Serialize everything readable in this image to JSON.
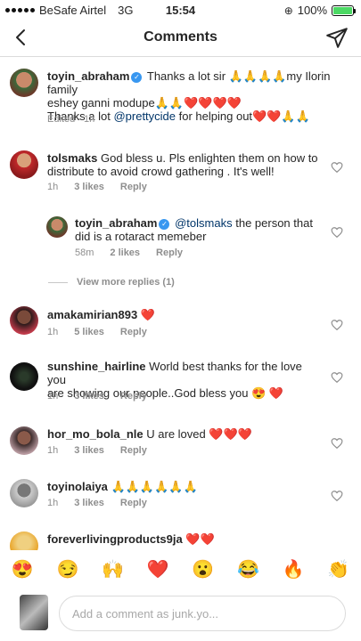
{
  "status_bar": {
    "carrier": "BeSafe Airtel",
    "network": "3G",
    "time": "15:54",
    "battery_pct": "100%",
    "battery_level": 1.0
  },
  "nav": {
    "title": "Comments",
    "back_icon": "chevron-left-icon",
    "send_icon": "paper-plane-icon"
  },
  "caption": {
    "username": "toyin_abraham",
    "line1": "Thanks a lot sir 🙏🙏🙏🙏my Ilorin family",
    "line2": "eshey ganni modupe🙏🙏❤️❤️❤️❤️",
    "line3_pre": "Thanks a lot",
    "mention": "@prettycide",
    "line3_post": "for helping out❤️❤️🙏🙏",
    "meta": "Edited · 1h"
  },
  "comments": [
    {
      "username": "tolsmaks",
      "line1": "God  bless u.  Pls enlighten them on how to",
      "line2": "distribute to avoid crowd gathering . It's well!",
      "time": "1h",
      "likes": "3 likes",
      "reply": "Reply"
    },
    {
      "username": "amakamirian893",
      "line1": "❤️",
      "time": "1h",
      "likes": "5 likes",
      "reply": "Reply"
    },
    {
      "username": "sunshine_hairline",
      "line1": "World best thanks for the love you",
      "line2": "are showing our people..God bless you 😍 ❤️",
      "time": "1h",
      "likes": "3 likes",
      "reply": "Reply"
    },
    {
      "username": "hor_mo_bola_nle",
      "line1": "U are loved ❤️❤️❤️",
      "time": "1h",
      "likes": "3 likes",
      "reply": "Reply"
    },
    {
      "username": "toyinolaiya",
      "line1": "🙏🙏🙏🙏🙏🙏",
      "time": "1h",
      "likes": "3 likes",
      "reply": "Reply"
    },
    {
      "username": "foreverlivingproducts9ja",
      "line1": "❤️❤️"
    }
  ],
  "reply": {
    "username": "toyin_abraham",
    "mention": "@tolsmaks",
    "line1": "the person that",
    "line2": "did is a rotaract memeber",
    "time": "58m",
    "likes": "2 likes",
    "reply": "Reply"
  },
  "view_replies": "View more replies (1)",
  "emoji_bar": [
    "😍",
    "😏",
    "🙌",
    "❤️",
    "😮",
    "😂",
    "🔥",
    "👏"
  ],
  "input": {
    "placeholder": "Add a comment as junk.yo..."
  }
}
